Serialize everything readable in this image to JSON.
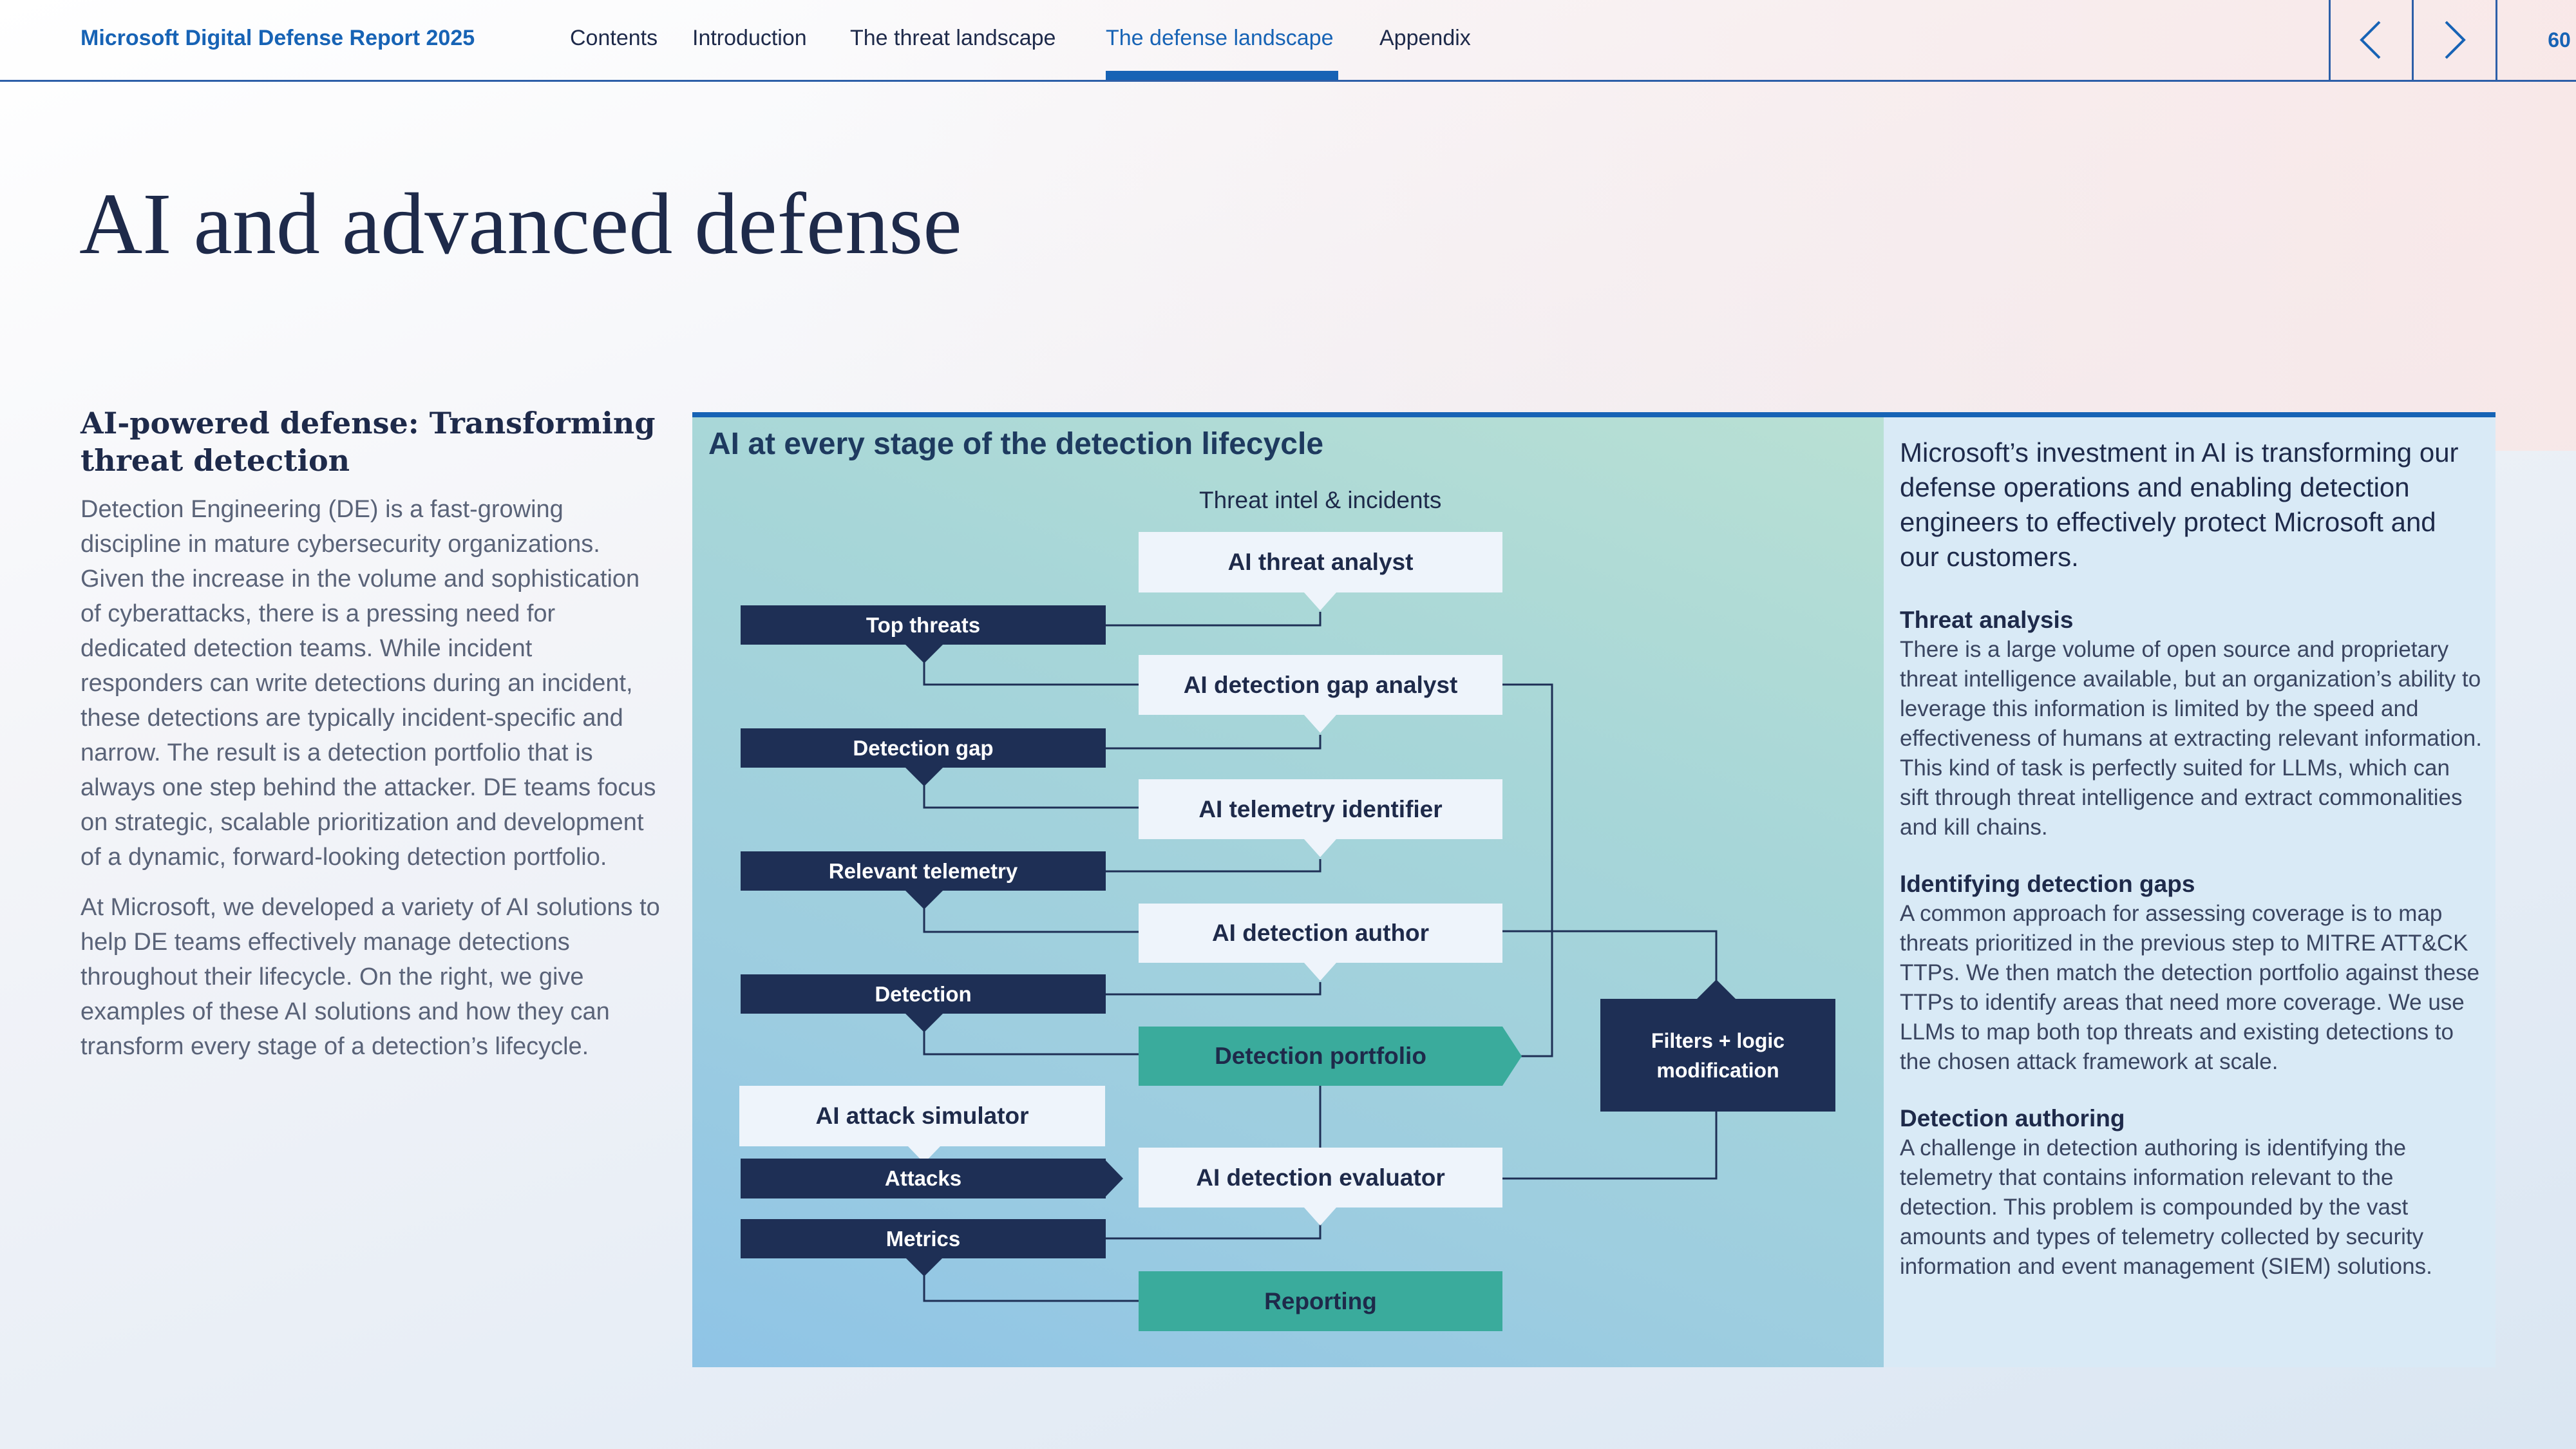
{
  "header": {
    "brand": "Microsoft Digital Defense Report 2025",
    "nav": [
      "Contents",
      "Introduction",
      "The threat landscape",
      "The defense landscape",
      "Appendix"
    ],
    "active_nav": "The defense landscape",
    "page_number": "60",
    "prev_icon": "chevron-left-icon",
    "next_icon": "chevron-right-icon"
  },
  "page_title": "AI and advanced defense",
  "left": {
    "heading": "AI-powered defense: Transforming threat detection",
    "paragraphs": [
      "Detection Engineering (DE) is a fast-growing discipline in mature cybersecurity organizations. Given the increase in the volume and sophistication of cyberattacks, there is a pressing need for dedicated detection teams. While incident responders can write detections during an incident, these detections are typically incident-specific and narrow. The result is a detection portfolio that is always one step behind the attacker. DE teams focus on strategic, scalable prioritization and development of a dynamic, forward-looking detection portfolio.",
      "At Microsoft, we developed a variety of AI solutions to help DE teams effectively manage detections throughout their lifecycle. On the right, we give examples of these AI solutions and how they can transform every stage of a detection’s lifecycle."
    ]
  },
  "diagram": {
    "title": "AI at every stage of the detection lifecycle",
    "input_label": "Threat intel & incidents",
    "ai_nodes": {
      "threat_analyst": "AI threat analyst",
      "gap_analyst": "AI detection gap analyst",
      "telemetry_identifier": "AI telemetry identifier",
      "detection_author": "AI detection author",
      "attack_simulator": "AI attack simulator",
      "detection_evaluator": "AI detection evaluator"
    },
    "outputs": {
      "top_threats": "Top threats",
      "detection_gap": "Detection gap",
      "relevant_telemetry": "Relevant telemetry",
      "detection": "Detection",
      "attacks": "Attacks",
      "metrics": "Metrics"
    },
    "results": {
      "detection_portfolio": "Detection portfolio",
      "reporting": "Reporting"
    },
    "filter_node": "Filters + logic modification",
    "colors": {
      "dark_node": "#1e2f55",
      "light_node": "#eef4fb",
      "teal_node": "#3aab9c",
      "accent": "#1763b5"
    }
  },
  "side": {
    "intro": "Microsoft’s investment in AI is transforming our defense operations and enabling detection engineers to effectively protect Microsoft and our customers.",
    "sections": [
      {
        "heading": "Threat analysis",
        "text": "There is a large volume of open source and proprietary threat intelligence available, but an organization’s ability to leverage this information is limited by the speed and effectiveness of humans at extracting relevant information. This kind of task is perfectly suited for LLMs, which can sift through threat intelligence and extract commonalities and kill chains."
      },
      {
        "heading": "Identifying detection gaps",
        "text": "A common approach for assessing coverage is to map threats prioritized in the previous step to MITRE ATT&CK TTPs. We then match the detection portfolio against these TTPs to identify areas that need more coverage. We use LLMs to map both top threats and existing detections to the chosen attack framework at scale."
      },
      {
        "heading": "Detection authoring",
        "text": "A challenge in detection authoring is identifying the telemetry that contains information relevant to the detection. This problem is compounded by the vast amounts and types of telemetry collected by security information and event management (SIEM) solutions."
      }
    ]
  }
}
